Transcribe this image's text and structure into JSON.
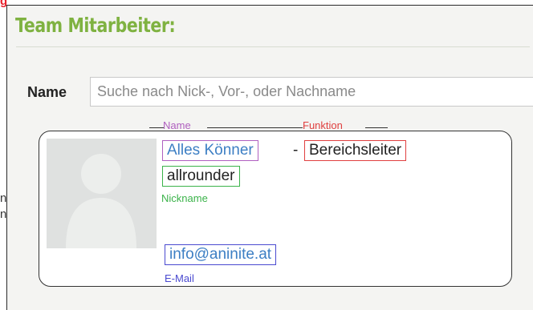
{
  "page": {
    "corner_mark": "g",
    "edge_text": [
      "n",
      "n"
    ]
  },
  "section": {
    "title": "Team Mitarbeiter:"
  },
  "search": {
    "label": "Name",
    "placeholder": "Suche nach Nick-, Vor-, oder Nachname",
    "value": ""
  },
  "member_card": {
    "name": "Alles Könner",
    "separator": "-",
    "function": "Bereichsleiter",
    "nickname": "allrounder",
    "email": "info@aninite.at"
  },
  "annotations": {
    "name": "Name",
    "function": "Funktion",
    "nickname": "Nickname",
    "email": "E-Mail"
  },
  "colors": {
    "title_green": "#7fb241",
    "name_purple": "#b060c0",
    "function_red": "#e04040",
    "nickname_green": "#3bb34a",
    "email_blue": "#4a4ad0",
    "link_blue": "#3d7fc4"
  },
  "icons": {
    "avatar": "person-silhouette-icon"
  }
}
